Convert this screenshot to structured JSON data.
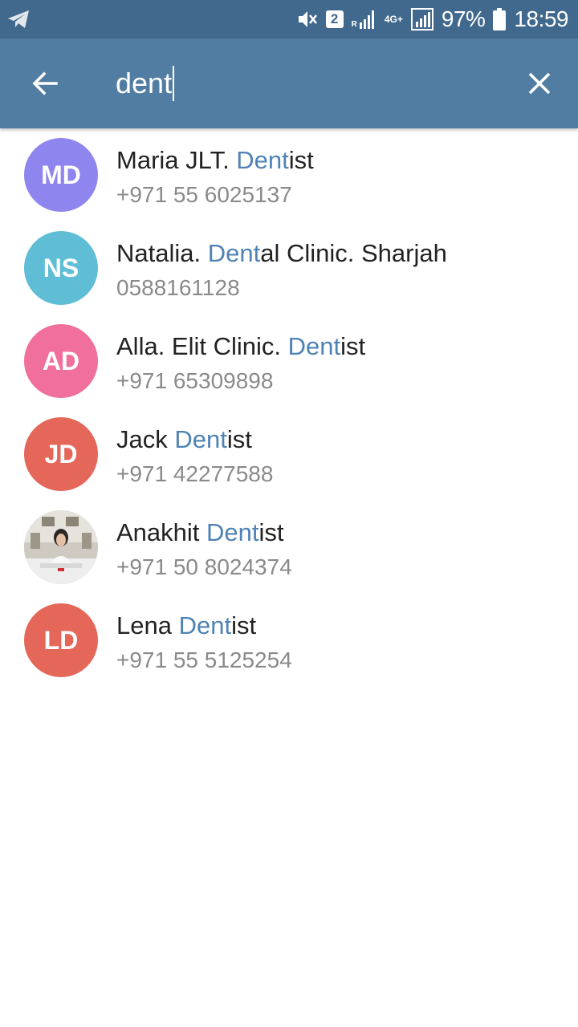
{
  "status_bar": {
    "sim_slot": "2",
    "network_type": "4G+",
    "roaming_indicator": "R",
    "battery": "97%",
    "time": "18:59",
    "icons": [
      "telegram-icon",
      "mute-icon",
      "signal-icon",
      "battery-icon"
    ]
  },
  "toolbar": {
    "search_value": "dent",
    "back_icon": "arrow-left-icon",
    "clear_icon": "close-icon"
  },
  "colors": {
    "status_bar_bg": "#41698d",
    "toolbar_bg": "#527da3",
    "highlight": "#4f83b5"
  },
  "results": [
    {
      "initials": "MD",
      "avatar_color": "#8e85ee",
      "name_before": "Maria JLT. ",
      "name_match": "Dent",
      "name_after": "ist",
      "phone": "+971 55 6025137"
    },
    {
      "initials": "NS",
      "avatar_color": "#5fbed5",
      "name_before": "Natalia. ",
      "name_match": "Dent",
      "name_after": "al Clinic. Sharjah",
      "phone": "0588161128"
    },
    {
      "initials": "AD",
      "avatar_color": "#f06f9c",
      "name_before": "Alla. Elit Clinic. ",
      "name_match": "Dent",
      "name_after": "ist",
      "phone": "+971 65309898"
    },
    {
      "initials": "JD",
      "avatar_color": "#e5675a",
      "name_before": "Jack ",
      "name_match": "Dent",
      "name_after": "ist",
      "phone": "+971 42277588"
    },
    {
      "initials": "",
      "avatar_color": "#d9d6cf",
      "name_before": "Anakhit ",
      "name_match": "Dent",
      "name_after": "ist",
      "phone": "+971 50 8024374"
    },
    {
      "initials": "LD",
      "avatar_color": "#e5675a",
      "name_before": "Lena ",
      "name_match": "Dent",
      "name_after": "ist",
      "phone": "+971 55 5125254"
    }
  ]
}
